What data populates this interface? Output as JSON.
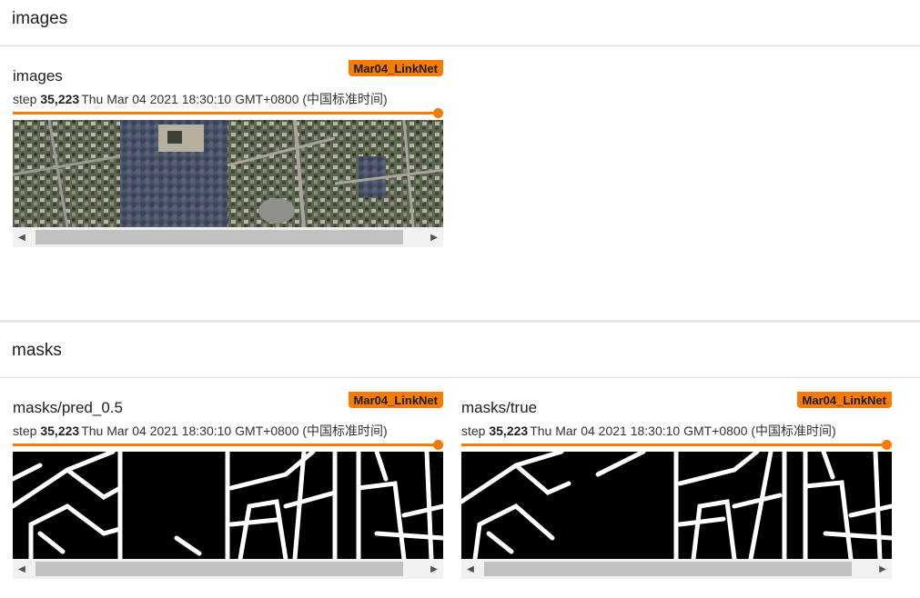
{
  "sections": [
    {
      "title": "images",
      "cards": [
        {
          "title": "images",
          "run": "Mar04_LinkNet",
          "step_label": "step",
          "step": "35,223",
          "time": "Thu Mar 04 2021 18:30:10 GMT+0800 (中国标准时间)",
          "image_kind": "satellite"
        }
      ]
    },
    {
      "title": "masks",
      "cards": [
        {
          "title": "masks/pred_0.5",
          "run": "Mar04_LinkNet",
          "step_label": "step",
          "step": "35,223",
          "time": "Thu Mar 04 2021 18:30:10 GMT+0800 (中国标准时间)",
          "image_kind": "mask"
        },
        {
          "title": "masks/true",
          "run": "Mar04_LinkNet",
          "step_label": "step",
          "step": "35,223",
          "time": "Thu Mar 04 2021 18:30:10 GMT+0800 (中国标准时间)",
          "image_kind": "mask"
        }
      ]
    }
  ],
  "colors": {
    "accent": "#f57c00"
  },
  "icons": {
    "scroll_left": "scroll-left-arrow-icon",
    "scroll_right": "scroll-right-arrow-icon"
  }
}
